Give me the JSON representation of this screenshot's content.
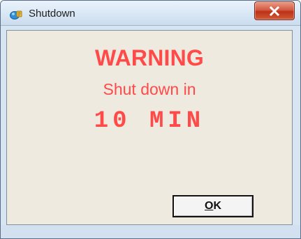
{
  "window": {
    "title": "Shutdown",
    "close_label": "Close",
    "colors": {
      "frame": "#d7e4f2",
      "content_background": "#eeeae0",
      "warning_text": "#ff4a4a",
      "close_button": "#c9482b"
    }
  },
  "dialog": {
    "heading": "WARNING",
    "message": "Shut down in",
    "countdown": "10 MIN"
  },
  "buttons": {
    "ok": {
      "mnemonic": "O",
      "rest": "K"
    }
  },
  "icons": {
    "app": "shutdown-app-icon",
    "close": "close-icon"
  }
}
